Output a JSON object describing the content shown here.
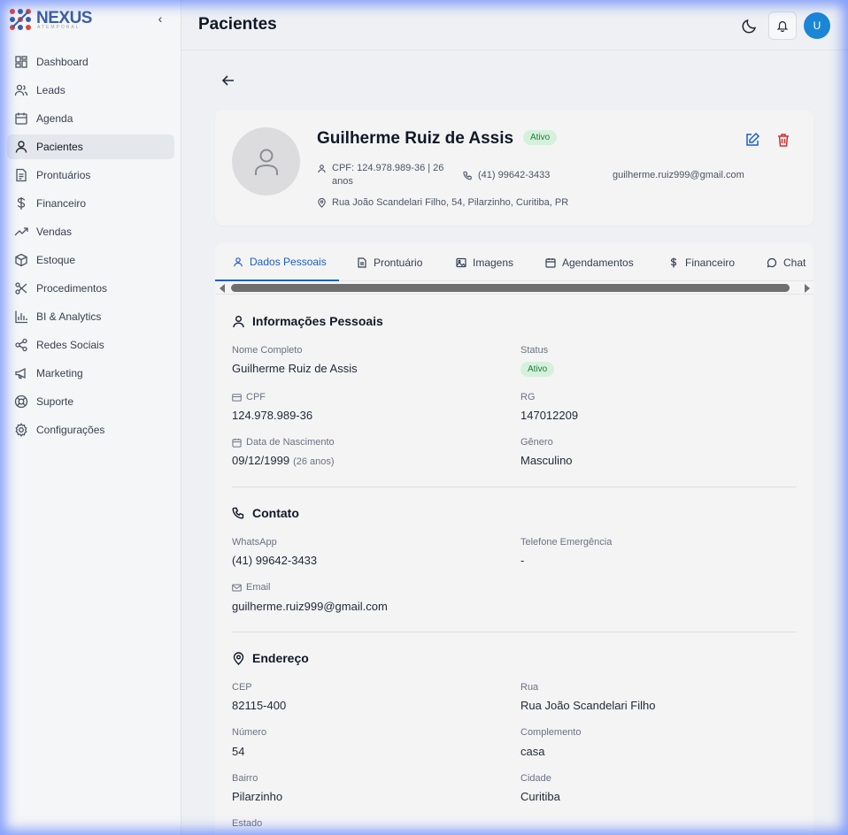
{
  "app": {
    "logo_text": "NEXUS",
    "logo_sub": "ATEMPORAL",
    "accent": "#1d5fbf"
  },
  "sidebar": {
    "collapse_label": "‹",
    "items": [
      {
        "label": "Dashboard",
        "icon": "grid-icon"
      },
      {
        "label": "Leads",
        "icon": "users-icon"
      },
      {
        "label": "Agenda",
        "icon": "calendar-icon"
      },
      {
        "label": "Pacientes",
        "icon": "user-icon",
        "active": true
      },
      {
        "label": "Prontuários",
        "icon": "document-icon"
      },
      {
        "label": "Financeiro",
        "icon": "dollar-icon"
      },
      {
        "label": "Vendas",
        "icon": "trending-up-icon"
      },
      {
        "label": "Estoque",
        "icon": "box-icon"
      },
      {
        "label": "Procedimentos",
        "icon": "scissors-icon"
      },
      {
        "label": "BI & Analytics",
        "icon": "bar-chart-icon"
      },
      {
        "label": "Redes Sociais",
        "icon": "share-icon"
      },
      {
        "label": "Marketing",
        "icon": "megaphone-icon"
      },
      {
        "label": "Suporte",
        "icon": "lifebuoy-icon"
      },
      {
        "label": "Configurações",
        "icon": "gear-icon"
      }
    ]
  },
  "header": {
    "title": "Pacientes",
    "avatar_initial": "U"
  },
  "patient": {
    "name": "Guilherme Ruiz de Assis",
    "status": "Ativo",
    "cpf_line": "CPF: 124.978.989-36 | 26 anos",
    "phone": "(41) 99642-3433",
    "email": "guilherme.ruiz999@gmail.com",
    "address": "Rua João Scandelari Filho, 54, Pilarzinho, Curitiba, PR"
  },
  "tabs": [
    {
      "label": "Dados Pessoais",
      "icon": "user-icon",
      "active": true
    },
    {
      "label": "Prontuário",
      "icon": "document-icon"
    },
    {
      "label": "Imagens",
      "icon": "image-icon"
    },
    {
      "label": "Agendamentos",
      "icon": "calendar-icon"
    },
    {
      "label": "Financeiro",
      "icon": "dollar-icon"
    },
    {
      "label": "Chat",
      "icon": "chat-icon"
    }
  ],
  "personal": {
    "heading": "Informações Pessoais",
    "nome_label": "Nome Completo",
    "nome_value": "Guilherme Ruiz de Assis",
    "status_label": "Status",
    "status_value": "Ativo",
    "cpf_label": "CPF",
    "cpf_value": "124.978.989-36",
    "rg_label": "RG",
    "rg_value": "147012209",
    "nasc_label": "Data de Nascimento",
    "nasc_value": "09/12/1999",
    "nasc_age": "(26 anos)",
    "genero_label": "Gênero",
    "genero_value": "Masculino"
  },
  "contact": {
    "heading": "Contato",
    "whatsapp_label": "WhatsApp",
    "whatsapp_value": "(41) 99642-3433",
    "emerg_label": "Telefone Emergência",
    "emerg_value": "-",
    "email_label": "Email",
    "email_value": "guilherme.ruiz999@gmail.com"
  },
  "address": {
    "heading": "Endereço",
    "cep_label": "CEP",
    "cep_value": "82115-400",
    "rua_label": "Rua",
    "rua_value": "Rua João Scandelari Filho",
    "numero_label": "Número",
    "numero_value": "54",
    "compl_label": "Complemento",
    "compl_value": "casa",
    "bairro_label": "Bairro",
    "bairro_value": "Pilarzinho",
    "cidade_label": "Cidade",
    "cidade_value": "Curitiba",
    "estado_label": "Estado"
  }
}
